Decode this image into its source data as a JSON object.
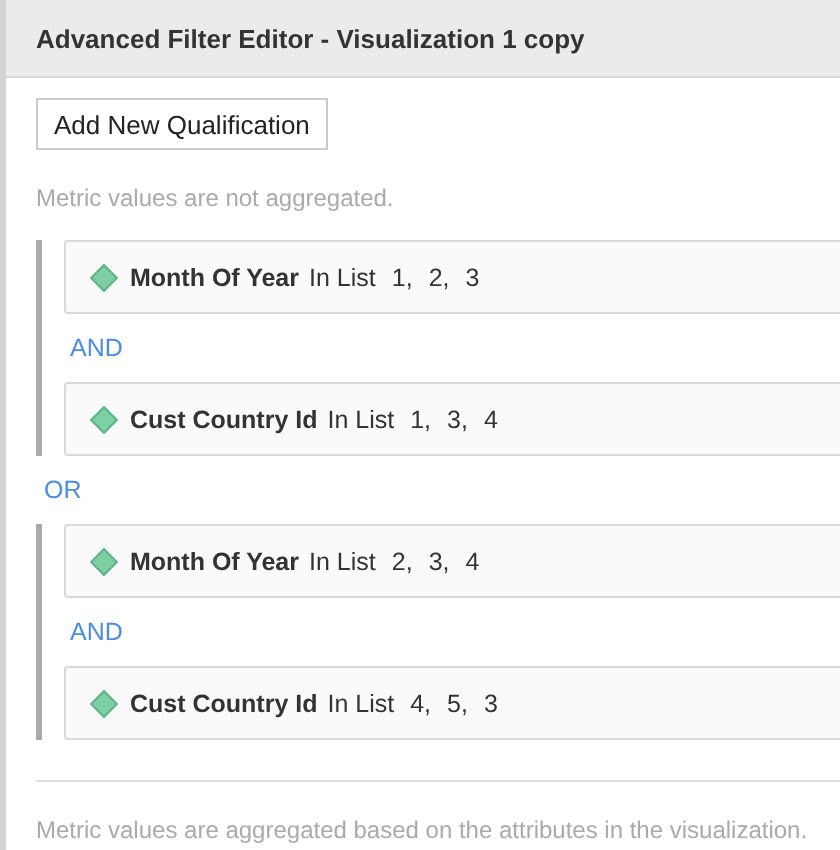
{
  "window": {
    "title": "Advanced Filter Editor - Visualization 1 copy"
  },
  "add_button": "Add New Qualification",
  "top_note": "Metric values are not aggregated.",
  "group_joiner": "OR",
  "groups": [
    {
      "joiner": "AND",
      "conditions": [
        {
          "attribute": "Month Of Year",
          "operator": "In List",
          "values": [
            "1,",
            "2,",
            "3"
          ]
        },
        {
          "attribute": "Cust Country Id",
          "operator": "In List",
          "values": [
            "1,",
            "3,",
            "4"
          ]
        }
      ]
    },
    {
      "joiner": "AND",
      "conditions": [
        {
          "attribute": "Month Of Year",
          "operator": "In List",
          "values": [
            "2,",
            "3,",
            "4"
          ]
        },
        {
          "attribute": "Cust Country Id",
          "operator": "In List",
          "values": [
            "4,",
            "5,",
            "3"
          ]
        }
      ]
    }
  ],
  "bottom_note": "Metric values are aggregated based on the attributes in the visualization."
}
